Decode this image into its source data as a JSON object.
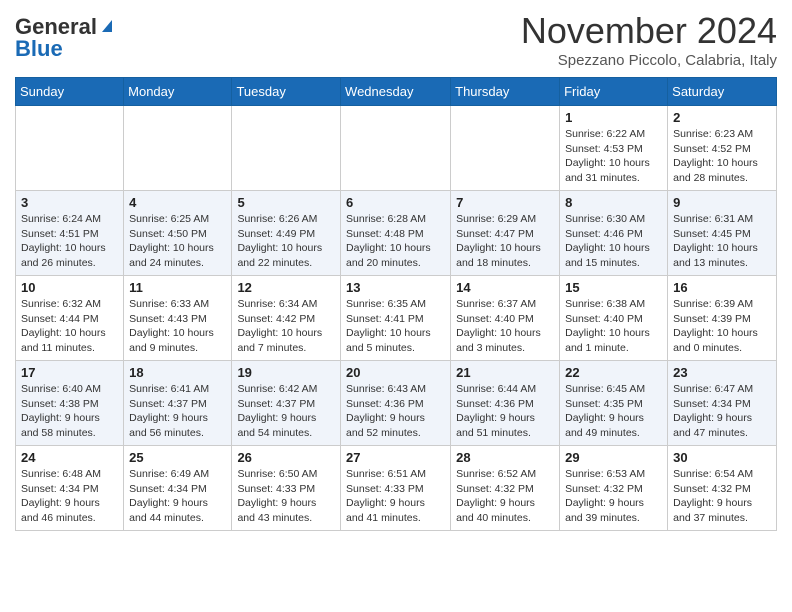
{
  "header": {
    "logo_general": "General",
    "logo_blue": "Blue",
    "month_title": "November 2024",
    "location": "Spezzano Piccolo, Calabria, Italy"
  },
  "days_of_week": [
    "Sunday",
    "Monday",
    "Tuesday",
    "Wednesday",
    "Thursday",
    "Friday",
    "Saturday"
  ],
  "weeks": [
    [
      {
        "day": "",
        "info": ""
      },
      {
        "day": "",
        "info": ""
      },
      {
        "day": "",
        "info": ""
      },
      {
        "day": "",
        "info": ""
      },
      {
        "day": "",
        "info": ""
      },
      {
        "day": "1",
        "info": "Sunrise: 6:22 AM\nSunset: 4:53 PM\nDaylight: 10 hours\nand 31 minutes."
      },
      {
        "day": "2",
        "info": "Sunrise: 6:23 AM\nSunset: 4:52 PM\nDaylight: 10 hours\nand 28 minutes."
      }
    ],
    [
      {
        "day": "3",
        "info": "Sunrise: 6:24 AM\nSunset: 4:51 PM\nDaylight: 10 hours\nand 26 minutes."
      },
      {
        "day": "4",
        "info": "Sunrise: 6:25 AM\nSunset: 4:50 PM\nDaylight: 10 hours\nand 24 minutes."
      },
      {
        "day": "5",
        "info": "Sunrise: 6:26 AM\nSunset: 4:49 PM\nDaylight: 10 hours\nand 22 minutes."
      },
      {
        "day": "6",
        "info": "Sunrise: 6:28 AM\nSunset: 4:48 PM\nDaylight: 10 hours\nand 20 minutes."
      },
      {
        "day": "7",
        "info": "Sunrise: 6:29 AM\nSunset: 4:47 PM\nDaylight: 10 hours\nand 18 minutes."
      },
      {
        "day": "8",
        "info": "Sunrise: 6:30 AM\nSunset: 4:46 PM\nDaylight: 10 hours\nand 15 minutes."
      },
      {
        "day": "9",
        "info": "Sunrise: 6:31 AM\nSunset: 4:45 PM\nDaylight: 10 hours\nand 13 minutes."
      }
    ],
    [
      {
        "day": "10",
        "info": "Sunrise: 6:32 AM\nSunset: 4:44 PM\nDaylight: 10 hours\nand 11 minutes."
      },
      {
        "day": "11",
        "info": "Sunrise: 6:33 AM\nSunset: 4:43 PM\nDaylight: 10 hours\nand 9 minutes."
      },
      {
        "day": "12",
        "info": "Sunrise: 6:34 AM\nSunset: 4:42 PM\nDaylight: 10 hours\nand 7 minutes."
      },
      {
        "day": "13",
        "info": "Sunrise: 6:35 AM\nSunset: 4:41 PM\nDaylight: 10 hours\nand 5 minutes."
      },
      {
        "day": "14",
        "info": "Sunrise: 6:37 AM\nSunset: 4:40 PM\nDaylight: 10 hours\nand 3 minutes."
      },
      {
        "day": "15",
        "info": "Sunrise: 6:38 AM\nSunset: 4:40 PM\nDaylight: 10 hours\nand 1 minute."
      },
      {
        "day": "16",
        "info": "Sunrise: 6:39 AM\nSunset: 4:39 PM\nDaylight: 10 hours\nand 0 minutes."
      }
    ],
    [
      {
        "day": "17",
        "info": "Sunrise: 6:40 AM\nSunset: 4:38 PM\nDaylight: 9 hours\nand 58 minutes."
      },
      {
        "day": "18",
        "info": "Sunrise: 6:41 AM\nSunset: 4:37 PM\nDaylight: 9 hours\nand 56 minutes."
      },
      {
        "day": "19",
        "info": "Sunrise: 6:42 AM\nSunset: 4:37 PM\nDaylight: 9 hours\nand 54 minutes."
      },
      {
        "day": "20",
        "info": "Sunrise: 6:43 AM\nSunset: 4:36 PM\nDaylight: 9 hours\nand 52 minutes."
      },
      {
        "day": "21",
        "info": "Sunrise: 6:44 AM\nSunset: 4:36 PM\nDaylight: 9 hours\nand 51 minutes."
      },
      {
        "day": "22",
        "info": "Sunrise: 6:45 AM\nSunset: 4:35 PM\nDaylight: 9 hours\nand 49 minutes."
      },
      {
        "day": "23",
        "info": "Sunrise: 6:47 AM\nSunset: 4:34 PM\nDaylight: 9 hours\nand 47 minutes."
      }
    ],
    [
      {
        "day": "24",
        "info": "Sunrise: 6:48 AM\nSunset: 4:34 PM\nDaylight: 9 hours\nand 46 minutes."
      },
      {
        "day": "25",
        "info": "Sunrise: 6:49 AM\nSunset: 4:34 PM\nDaylight: 9 hours\nand 44 minutes."
      },
      {
        "day": "26",
        "info": "Sunrise: 6:50 AM\nSunset: 4:33 PM\nDaylight: 9 hours\nand 43 minutes."
      },
      {
        "day": "27",
        "info": "Sunrise: 6:51 AM\nSunset: 4:33 PM\nDaylight: 9 hours\nand 41 minutes."
      },
      {
        "day": "28",
        "info": "Sunrise: 6:52 AM\nSunset: 4:32 PM\nDaylight: 9 hours\nand 40 minutes."
      },
      {
        "day": "29",
        "info": "Sunrise: 6:53 AM\nSunset: 4:32 PM\nDaylight: 9 hours\nand 39 minutes."
      },
      {
        "day": "30",
        "info": "Sunrise: 6:54 AM\nSunset: 4:32 PM\nDaylight: 9 hours\nand 37 minutes."
      }
    ]
  ]
}
